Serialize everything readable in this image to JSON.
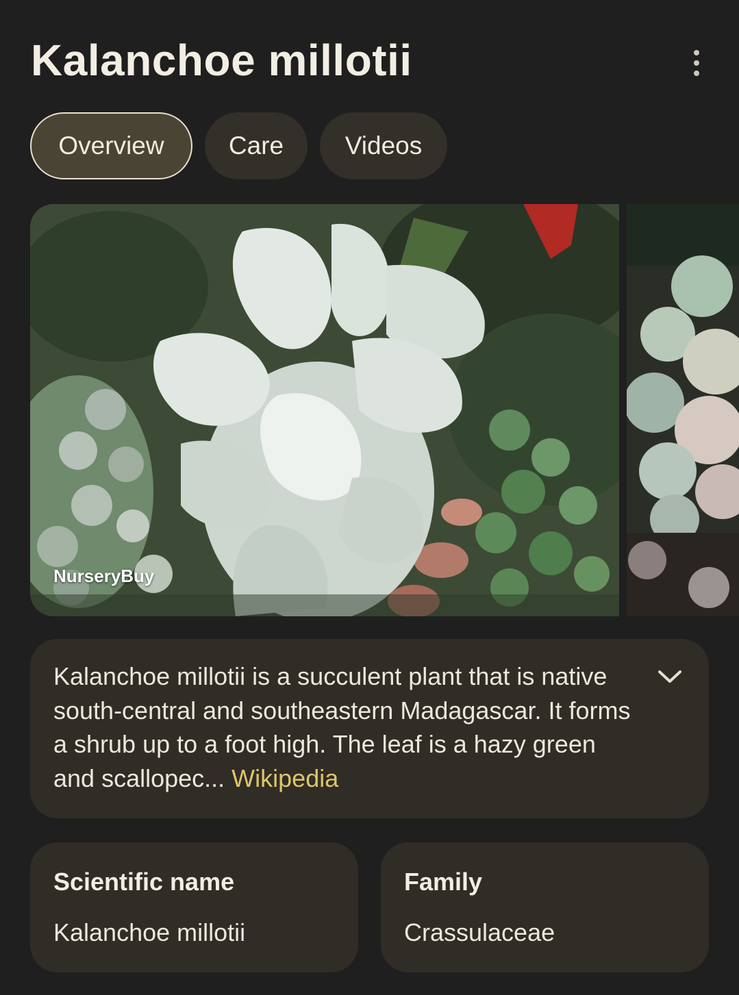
{
  "header": {
    "title": "Kalanchoe millotii",
    "more_icon": "more-vert-icon"
  },
  "tabs": [
    {
      "label": "Overview",
      "selected": true
    },
    {
      "label": "Care",
      "selected": false
    },
    {
      "label": "Videos",
      "selected": false
    }
  ],
  "gallery": {
    "main_image_credit": "NurseryBuy"
  },
  "description": {
    "text": "Kalanchoe millotii is a succulent plant that is native south-central and southeastern Madagascar. It forms a shrub up to a foot high. The leaf is a hazy green and scallopec...",
    "source_link": "Wikipedia",
    "expand_icon": "chevron-down-icon"
  },
  "facts": [
    {
      "label": "Scientific name",
      "value": "Kalanchoe millotii"
    },
    {
      "label": "Family",
      "value": "Crassulaceae"
    }
  ],
  "colors": {
    "background": "#1f1f1f",
    "card": "#302c26",
    "chip": "#332f29",
    "chip_selected": "#4a4434",
    "link": "#dcc669"
  }
}
